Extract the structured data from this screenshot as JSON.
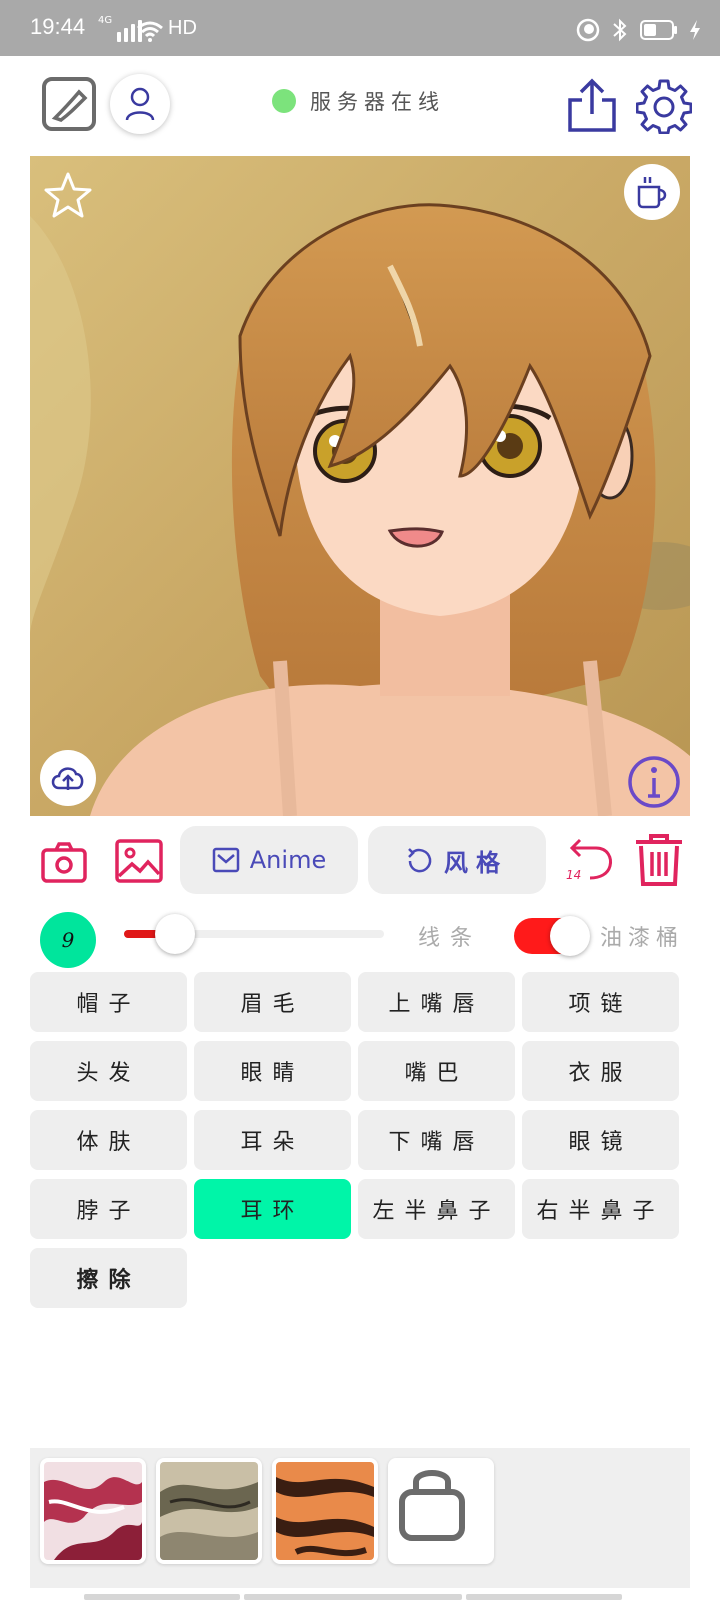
{
  "status_bar": {
    "time": "19:44",
    "network": "4G",
    "hd": "HD"
  },
  "header": {
    "server_status_text": "服务器在线",
    "server_status_color": "#7ce37c",
    "icons": [
      "edit-canvas-icon",
      "user-icon",
      "share-icon",
      "gear-icon"
    ]
  },
  "canvas": {
    "icons": [
      "star-icon",
      "coffee-cup-icon",
      "cloud-upload-icon",
      "info-icon"
    ]
  },
  "toolbar": {
    "anime_label": "Anime",
    "style_label": "风格",
    "undo_count": "14",
    "accent_color": "#e0245e",
    "pill_text_color": "#4a4ab8"
  },
  "brush": {
    "size": "9",
    "slider_level": 0.12,
    "mode_line_label": "线条",
    "mode_fill_label": "油漆桶",
    "fill_mode_on": true
  },
  "parts": [
    {
      "label": "帽子"
    },
    {
      "label": "眉毛"
    },
    {
      "label": "上嘴唇"
    },
    {
      "label": "项链"
    },
    {
      "label": "头发"
    },
    {
      "label": "眼睛"
    },
    {
      "label": "嘴巴"
    },
    {
      "label": "衣服"
    },
    {
      "label": "体肤"
    },
    {
      "label": "耳朵"
    },
    {
      "label": "下嘴唇"
    },
    {
      "label": "眼镜"
    },
    {
      "label": "脖子"
    },
    {
      "label": "耳环",
      "selected": true
    },
    {
      "label": "左半鼻子"
    },
    {
      "label": "右半鼻子"
    },
    {
      "label": "擦除"
    }
  ],
  "palette": {
    "swatches": [
      "pink-marble",
      "grey-stone",
      "orange-tiger"
    ],
    "locked_icon": "lock-icon"
  }
}
